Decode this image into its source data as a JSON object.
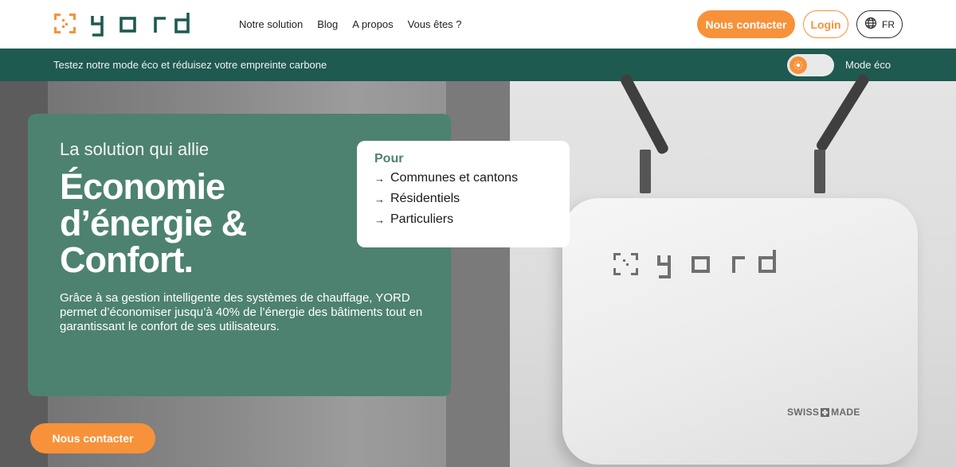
{
  "brand": {
    "name": "yord",
    "accent_color": "#f7923a",
    "primary_green": "#1e5a50",
    "card_green": "#4d8270"
  },
  "nav": {
    "items": [
      {
        "label": "Notre solution"
      },
      {
        "label": "Blog"
      },
      {
        "label": "A propos"
      },
      {
        "label": "Vous êtes ?"
      }
    ]
  },
  "header": {
    "contact_label": "Nous contacter",
    "login_label": "Login",
    "language": "FR",
    "language_icon": "globe-icon"
  },
  "ecobar": {
    "text": "Testez notre mode éco et réduisez votre empreinte carbone",
    "toggle_label": "Mode éco",
    "toggle_on": false,
    "toggle_icon": "sun-icon"
  },
  "hero": {
    "subtitle": "La solution qui allie",
    "title_lines": [
      "Économie",
      "d’énergie &",
      "Confort."
    ],
    "description": "Grâce à sa gestion intelligente des systèmes de chauffage, YORD permet d’économiser jusqu’à 40% de l’énergie des bâtiments tout en garantissant le confort de ses utilisateurs.",
    "pour": {
      "title": "Pour",
      "items": [
        "Communes et cantons",
        "Résidentiels",
        "Particuliers"
      ]
    },
    "device_badge": "SWISS MADE",
    "contact_label": "Nous contacter"
  }
}
